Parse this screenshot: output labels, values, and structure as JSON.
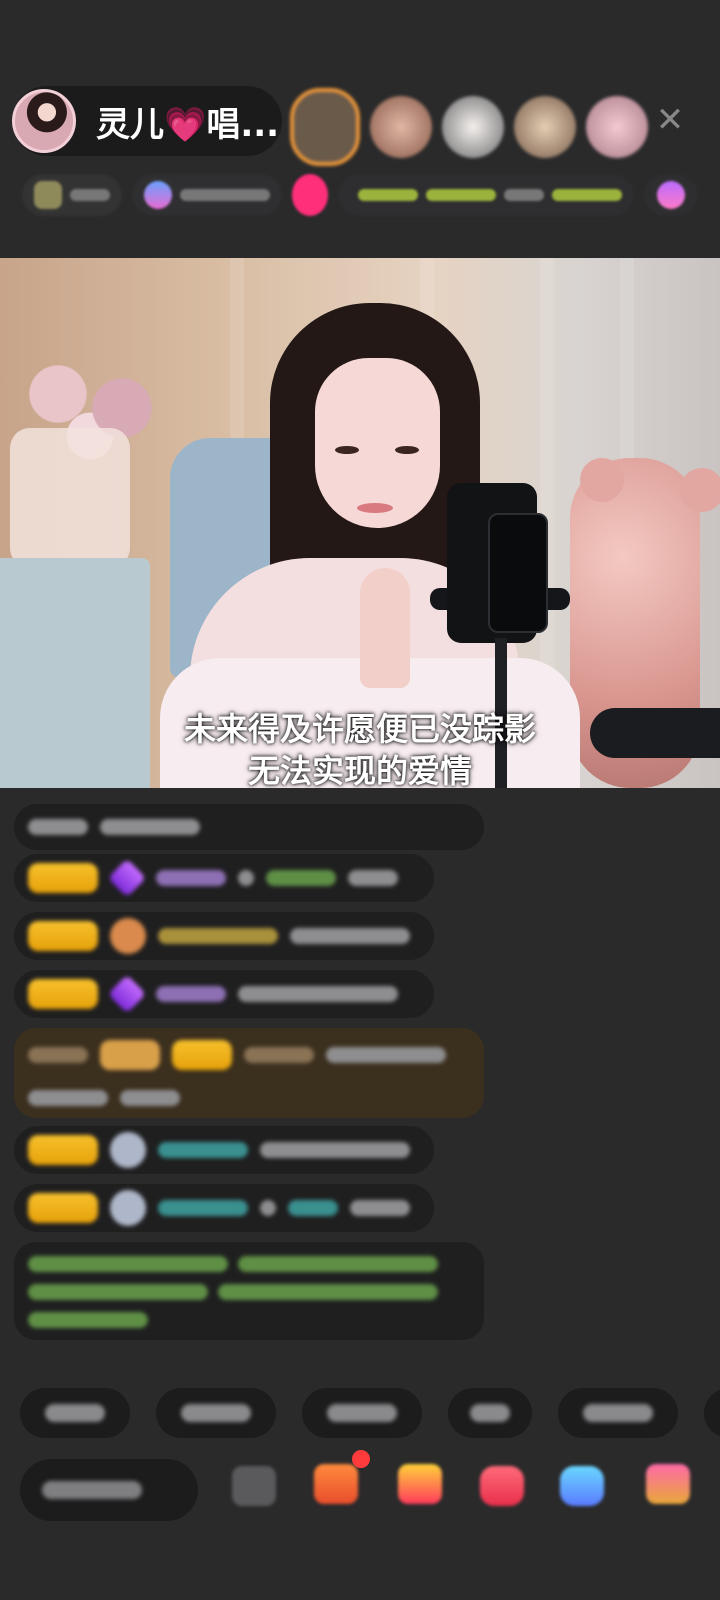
{
  "header": {
    "host_name": "灵儿",
    "host_name_suffix": "唱...",
    "heart": "💗",
    "close_icon": "✕"
  },
  "video": {
    "lyric_line_1": "未来得及许愿便已没踪影",
    "lyric_line_2": "无法实现的爱情"
  },
  "colors": {
    "background": "#2a2a2b",
    "badge_gold": "#f7c12c",
    "accent_pink": "#ff4fa0"
  }
}
